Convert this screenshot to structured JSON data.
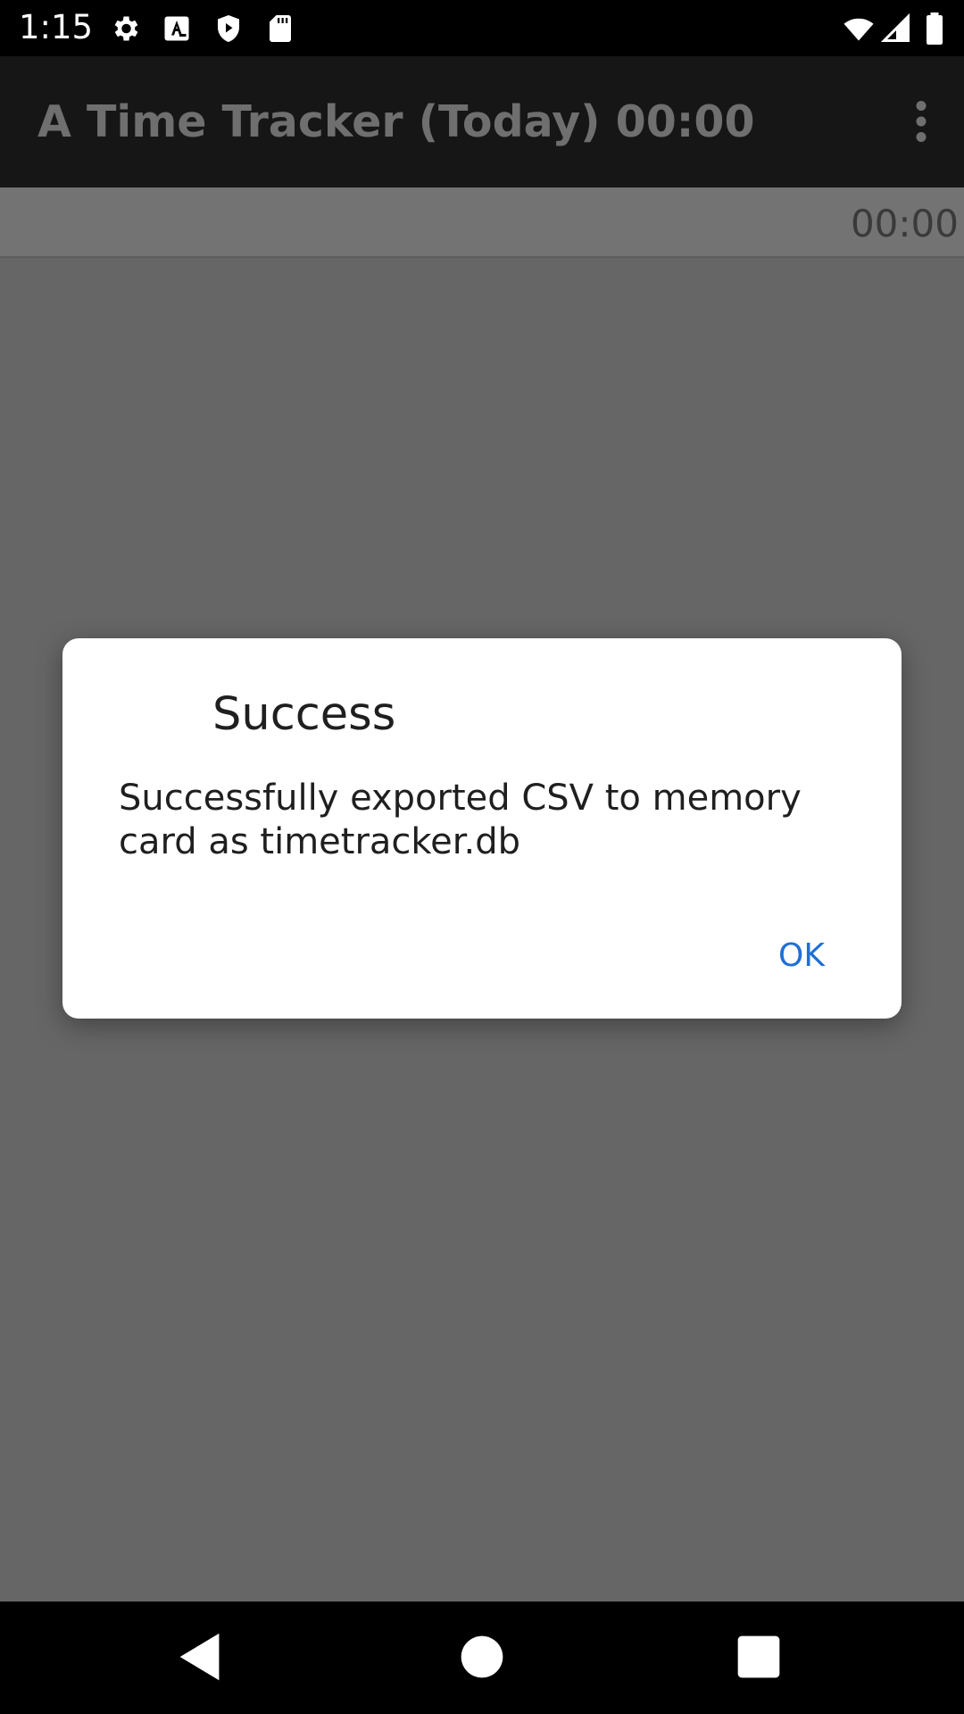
{
  "status_bar": {
    "time": "1:15",
    "icons": [
      "settings-icon",
      "a-text-icon",
      "shield-play-icon",
      "sd-card-icon",
      "wifi-icon",
      "signal-icon",
      "battery-icon"
    ]
  },
  "app_bar": {
    "title": "A Time Tracker (Today) 00:00",
    "menu_icon": "more-vert-icon"
  },
  "content": {
    "total_time": "00:00"
  },
  "dialog": {
    "title": "Success",
    "message": "Successfully exported CSV to memory card as timetracker.db",
    "ok_label": "OK"
  },
  "colors": {
    "accent": "#1f6fd6",
    "app_bar": "#161616",
    "scrim": "#666666"
  },
  "nav_bar": {
    "icons": [
      "back-icon",
      "home-icon",
      "recents-icon"
    ]
  }
}
